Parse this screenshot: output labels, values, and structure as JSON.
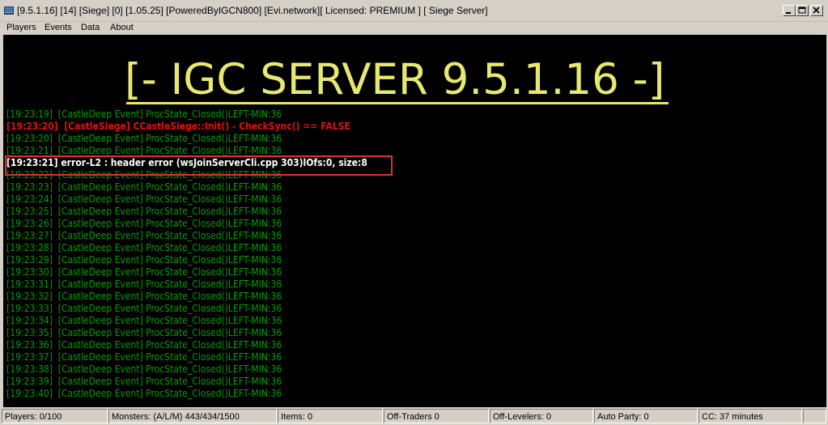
{
  "window": {
    "title": "[9.5.1.16] [14] [Siege] [0] [1.05.25] [PoweredByIGCN800] [Evi.network][ Licensed: PREMIUM ] [ Siege Server]"
  },
  "menu": {
    "players": "Players",
    "events": "Events",
    "data": "Data",
    "about": "About"
  },
  "banner": "[- IGC SERVER 9.5.1.16 -]",
  "log": [
    {
      "text": "[19:23:19]  [CastleDeep Event] ProcState_Closed()LEFT-MIN:36",
      "color": "green"
    },
    {
      "text": "[19:23:20]  [CastleSiege] CCastleSiege::Init() - CheckSync() == FALSE",
      "color": "red"
    },
    {
      "text": "[19:23:20]  [CastleDeep Event] ProcState_Closed()LEFT-MIN:36",
      "color": "green"
    },
    {
      "text": "[19:23:21]  [CastleDeep Event] ProcState_Closed()LEFT-MIN:36",
      "color": "green"
    },
    {
      "text": "[19:23:21] error-L2 : header error (wsJoinServerCli.cpp 303)lOfs:0, size:8",
      "color": "white"
    },
    {
      "text": "[19:23:22]  [CastleDeep Event] ProcState_Closed()LEFT-MIN:36",
      "color": "green"
    },
    {
      "text": "[19:23:23]  [CastleDeep Event] ProcState_Closed()LEFT-MIN:36",
      "color": "green"
    },
    {
      "text": "[19:23:24]  [CastleDeep Event] ProcState_Closed()LEFT-MIN:36",
      "color": "green"
    },
    {
      "text": "[19:23:25]  [CastleDeep Event] ProcState_Closed()LEFT-MIN:36",
      "color": "green"
    },
    {
      "text": "[19:23:26]  [CastleDeep Event] ProcState_Closed()LEFT-MIN:36",
      "color": "green"
    },
    {
      "text": "[19:23:27]  [CastleDeep Event] ProcState_Closed()LEFT-MIN:36",
      "color": "green"
    },
    {
      "text": "[19:23:28]  [CastleDeep Event] ProcState_Closed()LEFT-MIN:36",
      "color": "green"
    },
    {
      "text": "[19:23:29]  [CastleDeep Event] ProcState_Closed()LEFT-MIN:36",
      "color": "green"
    },
    {
      "text": "[19:23:30]  [CastleDeep Event] ProcState_Closed()LEFT-MIN:36",
      "color": "green"
    },
    {
      "text": "[19:23:31]  [CastleDeep Event] ProcState_Closed()LEFT-MIN:36",
      "color": "green"
    },
    {
      "text": "[19:23:32]  [CastleDeep Event] ProcState_Closed()LEFT-MIN:36",
      "color": "green"
    },
    {
      "text": "[19:23:33]  [CastleDeep Event] ProcState_Closed()LEFT-MIN:36",
      "color": "green"
    },
    {
      "text": "[19:23:34]  [CastleDeep Event] ProcState_Closed()LEFT-MIN:36",
      "color": "green"
    },
    {
      "text": "[19:23:35]  [CastleDeep Event] ProcState_Closed()LEFT-MIN:36",
      "color": "green"
    },
    {
      "text": "[19:23:36]  [CastleDeep Event] ProcState_Closed()LEFT-MIN:36",
      "color": "green"
    },
    {
      "text": "[19:23:37]  [CastleDeep Event] ProcState_Closed()LEFT-MIN:36",
      "color": "green"
    },
    {
      "text": "[19:23:38]  [CastleDeep Event] ProcState_Closed()LEFT-MIN:36",
      "color": "green"
    },
    {
      "text": "[19:23:39]  [CastleDeep Event] ProcState_Closed()LEFT-MIN:36",
      "color": "green"
    },
    {
      "text": "[19:23:40]  [CastleDeep Event] ProcState_Closed()LEFT-MIN:36",
      "color": "green"
    }
  ],
  "status": {
    "players": "Players: 0/100",
    "monsters": "Monsters: (A/L/M) 443/434/1500",
    "items": "Items: 0",
    "off_traders": "Off-Traders 0",
    "off_levelers": "Off-Levelers: 0",
    "auto_party": "Auto Party: 0",
    "cc": "CC: 37 minutes"
  },
  "colors": {
    "green": "#00a000",
    "red": "#e01010",
    "white": "#ffffff",
    "banner": "#e8e870",
    "highlight": "#e03030"
  },
  "icons": {
    "app": "server-app-icon",
    "minimize": "minimize-icon",
    "maximize": "maximize-icon",
    "close": "close-icon"
  }
}
